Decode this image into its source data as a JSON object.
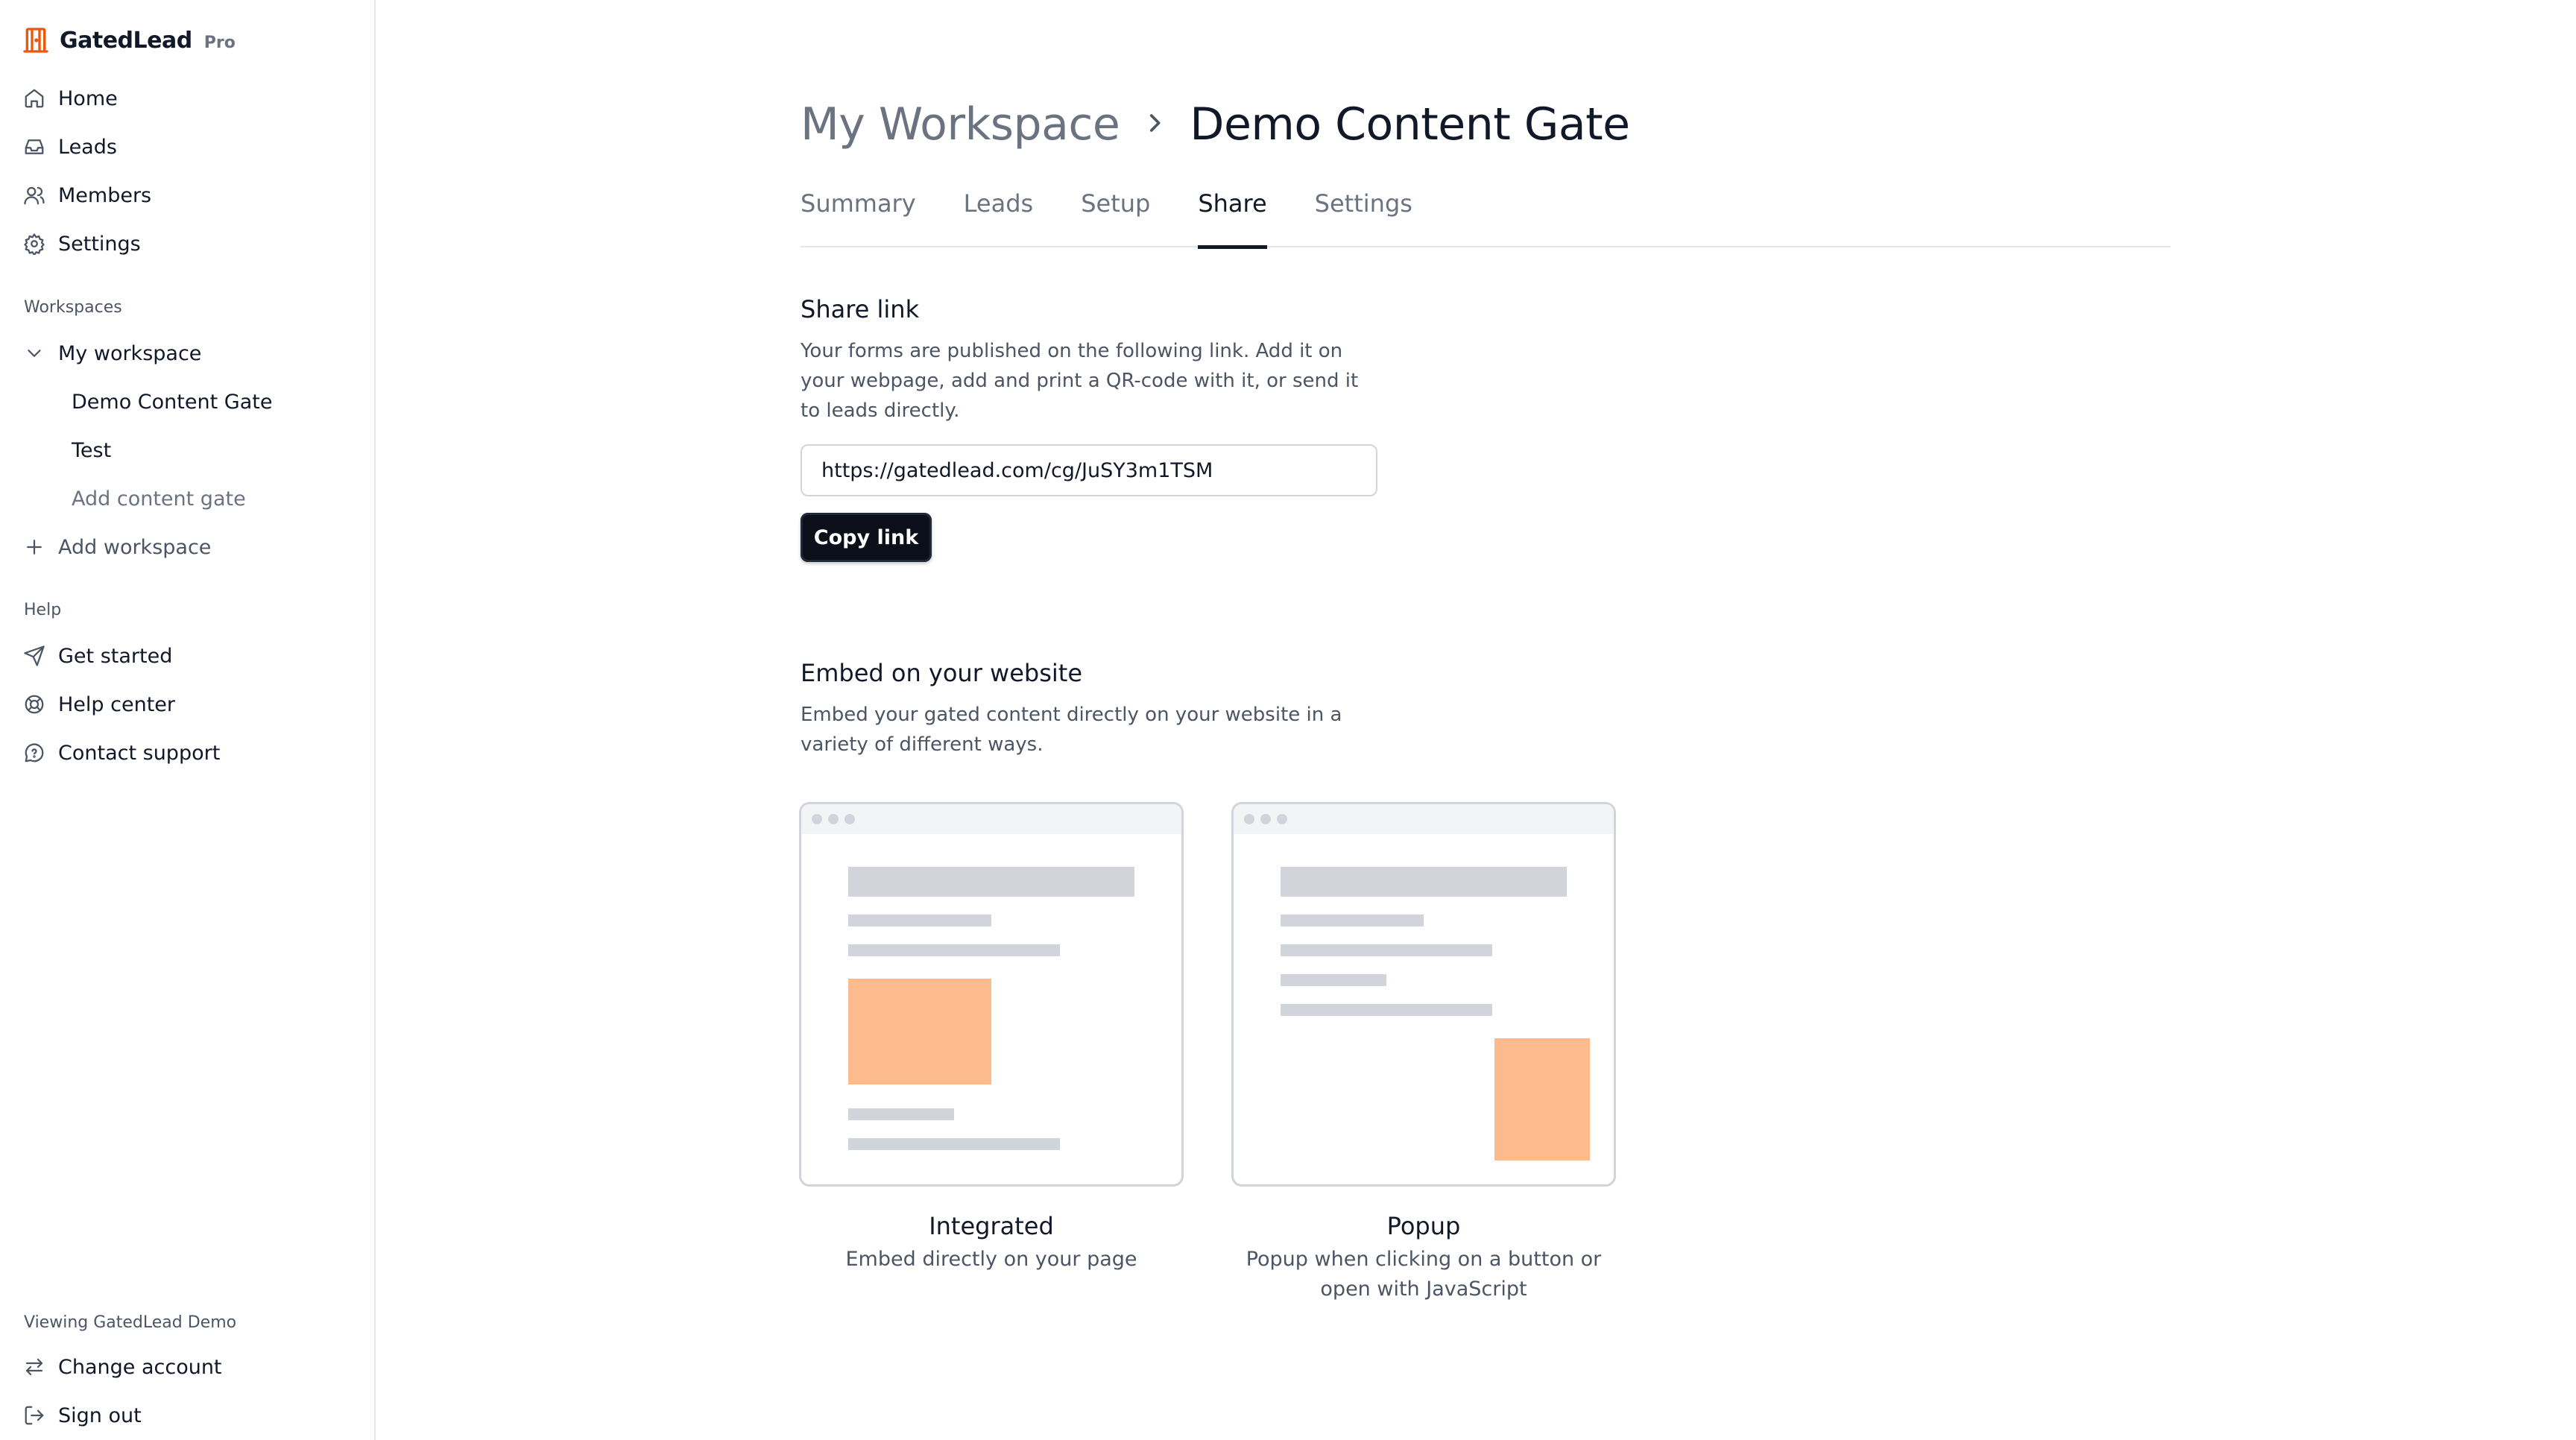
{
  "brand": {
    "name": "GatedLead",
    "tier": "Pro",
    "logo_color": "#ea580c"
  },
  "sidebar": {
    "nav": [
      {
        "label": "Home",
        "icon": "home-icon"
      },
      {
        "label": "Leads",
        "icon": "inbox-icon"
      },
      {
        "label": "Members",
        "icon": "users-icon"
      },
      {
        "label": "Settings",
        "icon": "gear-icon"
      }
    ],
    "workspaces_label": "Workspaces",
    "workspace": {
      "label": "My workspace",
      "icon": "chevron-down-icon"
    },
    "workspace_items": [
      "Demo Content Gate",
      "Test"
    ],
    "add_content_gate": "Add content gate",
    "add_workspace": "Add workspace",
    "help_label": "Help",
    "help": [
      {
        "label": "Get started",
        "icon": "send-icon"
      },
      {
        "label": "Help center",
        "icon": "lifebuoy-icon"
      },
      {
        "label": "Contact support",
        "icon": "chat-icon"
      }
    ],
    "viewing": "Viewing GatedLead Demo",
    "change_account": "Change account",
    "sign_out": "Sign out"
  },
  "breadcrumb": {
    "parent": "My Workspace",
    "current": "Demo Content Gate"
  },
  "tabs": [
    {
      "label": "Summary",
      "active": false
    },
    {
      "label": "Leads",
      "active": false
    },
    {
      "label": "Setup",
      "active": false
    },
    {
      "label": "Share",
      "active": true
    },
    {
      "label": "Settings",
      "active": false
    }
  ],
  "share": {
    "title": "Share link",
    "description": "Your forms are published on the following link. Add it on your webpage, add and print a QR-code with it, or send it to leads directly.",
    "url": "https://gatedlead.com/cg/JuSY3m1TSM",
    "copy_label": "Copy link"
  },
  "embed": {
    "title": "Embed on your website",
    "description": "Embed your gated content directly on your website in a variety of different ways.",
    "options": [
      {
        "title": "Integrated",
        "description": "Embed directly on your page"
      },
      {
        "title": "Popup",
        "description": "Popup when clicking on a button or open with JavaScript"
      }
    ]
  },
  "colors": {
    "accent_orange": "#fdba8c",
    "placeholder_gray": "#d1d5db",
    "primary_dark": "#0b0f19"
  }
}
